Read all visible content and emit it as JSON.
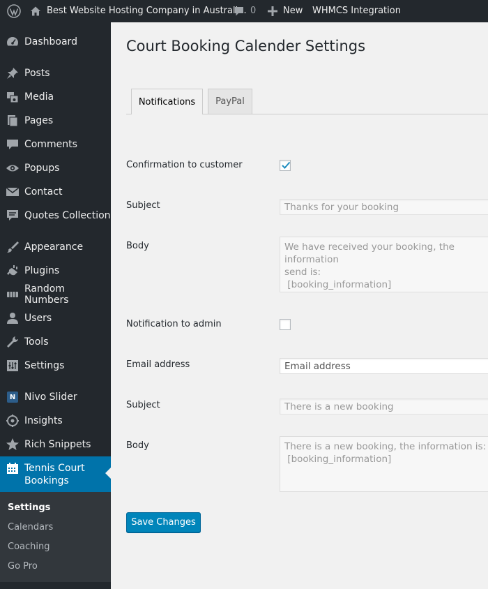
{
  "adminbar": {
    "site_name": "Best Website Hosting Company in Australi...",
    "comments_count": "0",
    "new_label": "New",
    "whmcs_label": "WHMCS Integration"
  },
  "sidebar": {
    "items": [
      {
        "label": "Dashboard",
        "icon": "dashboard-icon"
      },
      {
        "label": "Posts",
        "icon": "pin-icon"
      },
      {
        "label": "Media",
        "icon": "media-icon"
      },
      {
        "label": "Pages",
        "icon": "pages-icon"
      },
      {
        "label": "Comments",
        "icon": "comment-icon"
      },
      {
        "label": "Popups",
        "icon": "eye-icon"
      },
      {
        "label": "Contact",
        "icon": "mail-icon"
      },
      {
        "label": "Quotes Collection",
        "icon": "quote-icon"
      },
      {
        "label": "Appearance",
        "icon": "brush-icon"
      },
      {
        "label": "Plugins",
        "icon": "plugin-icon"
      },
      {
        "label": "Random Numbers",
        "icon": "numbers-icon"
      },
      {
        "label": "Users",
        "icon": "user-icon"
      },
      {
        "label": "Tools",
        "icon": "wrench-icon"
      },
      {
        "label": "Settings",
        "icon": "sliders-icon"
      },
      {
        "label": "Nivo Slider",
        "icon": "nivo-icon"
      },
      {
        "label": "Insights",
        "icon": "insights-icon"
      },
      {
        "label": "Rich Snippets",
        "icon": "star-icon"
      },
      {
        "label_line1": "Tennis Court",
        "label_line2": "Bookings",
        "icon": "calendar-icon"
      }
    ],
    "nivo_letter": "N",
    "submenu": [
      "Settings",
      "Calendars",
      "Coaching",
      "Go Pro"
    ]
  },
  "page": {
    "title": "Court Booking Calender Settings",
    "tabs": [
      "Notifications",
      "PayPal"
    ]
  },
  "form": {
    "confirmation_label": "Confirmation to customer",
    "confirmation_checked": true,
    "subject_label": "Subject",
    "customer_subject_value": "Thanks for your booking",
    "body_label": "Body",
    "customer_body_value": "We have received your booking, the information\nsend is:\n [booking_information]",
    "notify_admin_label": "Notification to admin",
    "notify_admin_checked": false,
    "email_label": "Email address",
    "email_placeholder": "Email address",
    "admin_subject_value": "There is a new booking",
    "admin_body_value": "There is a new booking, the information is:\n [booking_information]",
    "save_label": "Save Changes"
  },
  "colors": {
    "adminbar_bg": "#23282d",
    "current_menu_bg": "#0073aa",
    "button_bg": "#0085ba"
  }
}
